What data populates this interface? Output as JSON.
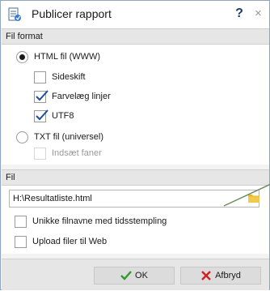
{
  "window": {
    "title": "Publicer rapport",
    "help_label": "?",
    "close_label": "×"
  },
  "file_format": {
    "header": "Fil format",
    "html_option": {
      "label": "HTML fil (WWW)",
      "selected": true
    },
    "page_break": {
      "label": "Sideskift",
      "checked": false
    },
    "color_lines": {
      "label": "Farvelæg linjer",
      "checked": true
    },
    "utf8": {
      "label": "UTF8",
      "checked": true
    },
    "txt_option": {
      "label": "TXT fil (universel)",
      "selected": false
    },
    "insert_tabs": {
      "label": "Indsæt faner",
      "checked": false,
      "disabled": true
    }
  },
  "file": {
    "header": "Fil",
    "path_value": "H:\\Resultatliste.html",
    "unique_names": {
      "label": "Unikke filnavne med tidsstempling",
      "checked": false
    },
    "upload_web": {
      "label": "Upload filer til Web",
      "checked": false
    }
  },
  "buttons": {
    "ok_label": "OK",
    "cancel_label": "Afbryd"
  },
  "colors": {
    "check_blue": "#1f4e9a",
    "ok_green": "#2e9a2e",
    "cancel_red": "#d42020",
    "folder_yellow": "#e8b820",
    "pointer_line": "#6b8c5a"
  }
}
